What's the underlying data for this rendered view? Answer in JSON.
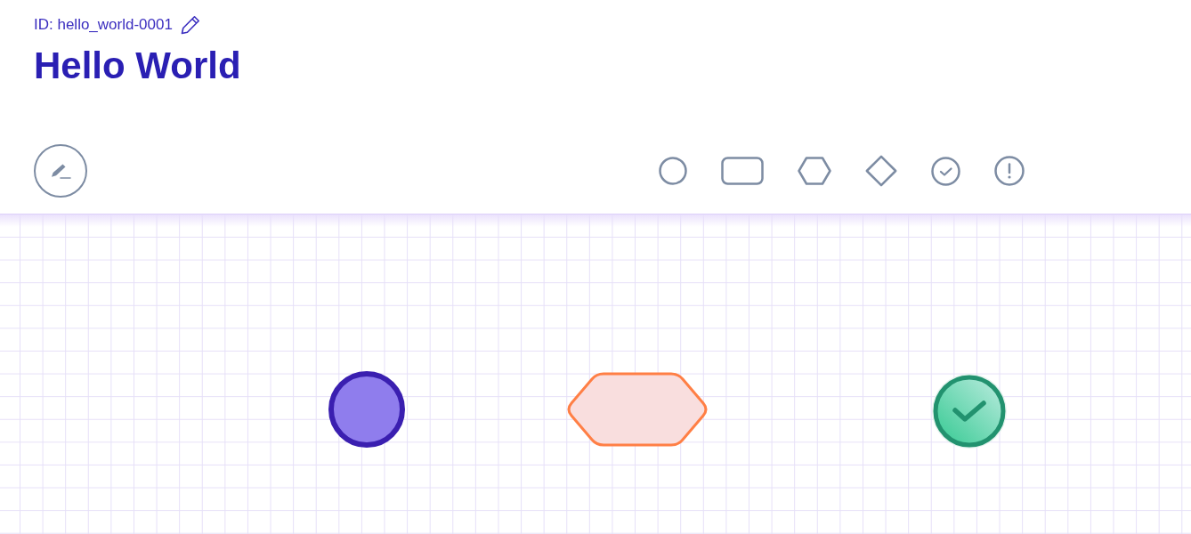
{
  "header": {
    "id_label": "ID: hello_world-0001",
    "title": "Hello World"
  },
  "canvas": {
    "nodes": [
      {
        "kind": "circle"
      },
      {
        "kind": "hexagon"
      },
      {
        "kind": "check"
      }
    ]
  }
}
